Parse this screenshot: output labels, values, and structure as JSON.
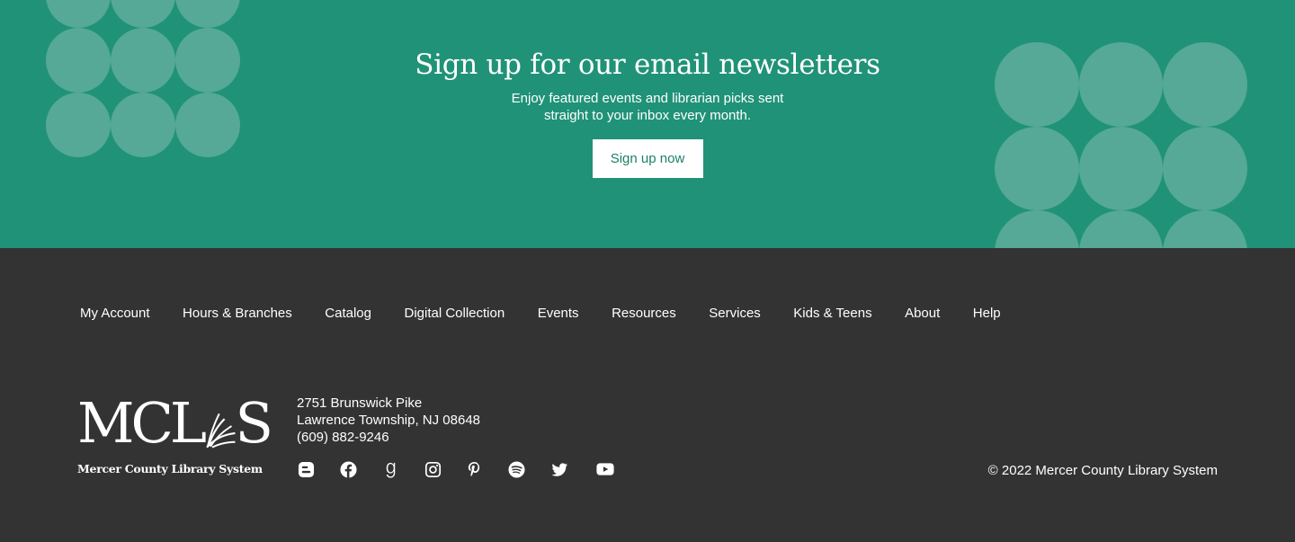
{
  "newsletter": {
    "title": "Sign up for our email newsletters",
    "subtitle_line1": "Enjoy featured events and librarian picks sent",
    "subtitle_line2": "straight to your inbox every month.",
    "button_label": "Sign up now",
    "background_color": "#209278",
    "dot_color": "#55a996"
  },
  "footer": {
    "nav": [
      "My Account",
      "Hours & Branches",
      "Catalog",
      "Digital Collection",
      "Events",
      "Resources",
      "Services",
      "Kids & Teens",
      "About",
      "Help"
    ],
    "logo": {
      "mark": "MCLS",
      "name": "Mercer County Library System"
    },
    "address": {
      "street": "2751 Brunswick Pike",
      "city": "Lawrence Township, NJ 08648",
      "phone": "(609) 882-9246"
    },
    "social": [
      "blogger-icon",
      "facebook-icon",
      "goodreads-icon",
      "instagram-icon",
      "pinterest-icon",
      "spotify-icon",
      "twitter-icon",
      "youtube-icon"
    ],
    "copyright": "© 2022 Mercer County Library System",
    "background_color": "#333333"
  }
}
